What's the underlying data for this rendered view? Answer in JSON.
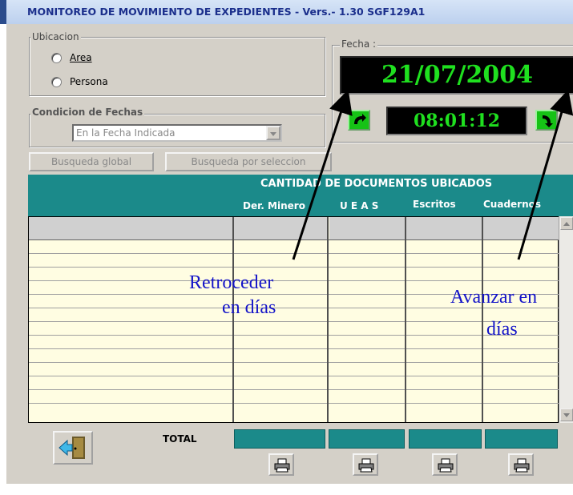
{
  "window": {
    "title": "MONITOREO DE MOVIMIENTO DE EXPEDIENTES - Vers.- 1.30 SGF129A1"
  },
  "ubicacion": {
    "legend": "Ubicacion",
    "options": [
      {
        "label": "Area",
        "selected": false
      },
      {
        "label": "Persona",
        "selected": false
      }
    ]
  },
  "condicion": {
    "legend": "Condicion de Fechas",
    "selected_value": "En la Fecha Indicada"
  },
  "fecha": {
    "legend": "Fecha :",
    "date": "21/07/2004",
    "time": "08:01:12"
  },
  "buttons": {
    "busqueda_global": "Busqueda global",
    "busqueda_seleccion": "Busqueda por seleccion"
  },
  "grid": {
    "title": "CANTIDAD DE DOCUMENTOS UBICADOS",
    "columns": [
      "Der. Minero",
      "U E A S",
      "Escritos",
      "Cuadernos"
    ]
  },
  "footer": {
    "total_label": "TOTAL"
  },
  "annotations": {
    "retroceder_line1": "Retroceder",
    "retroceder_line2": "en días",
    "avanzar_line1": "Avanzar en",
    "avanzar_line2": "días"
  },
  "colors": {
    "header_teal": "#1b8a8a",
    "grid_background": "#fffde2",
    "display_green": "#1fe01f",
    "annotation_blue": "#1414c8"
  },
  "icons": [
    "back-arrow-icon",
    "forward-arrow-icon",
    "exit-door-icon",
    "printer-icon"
  ]
}
